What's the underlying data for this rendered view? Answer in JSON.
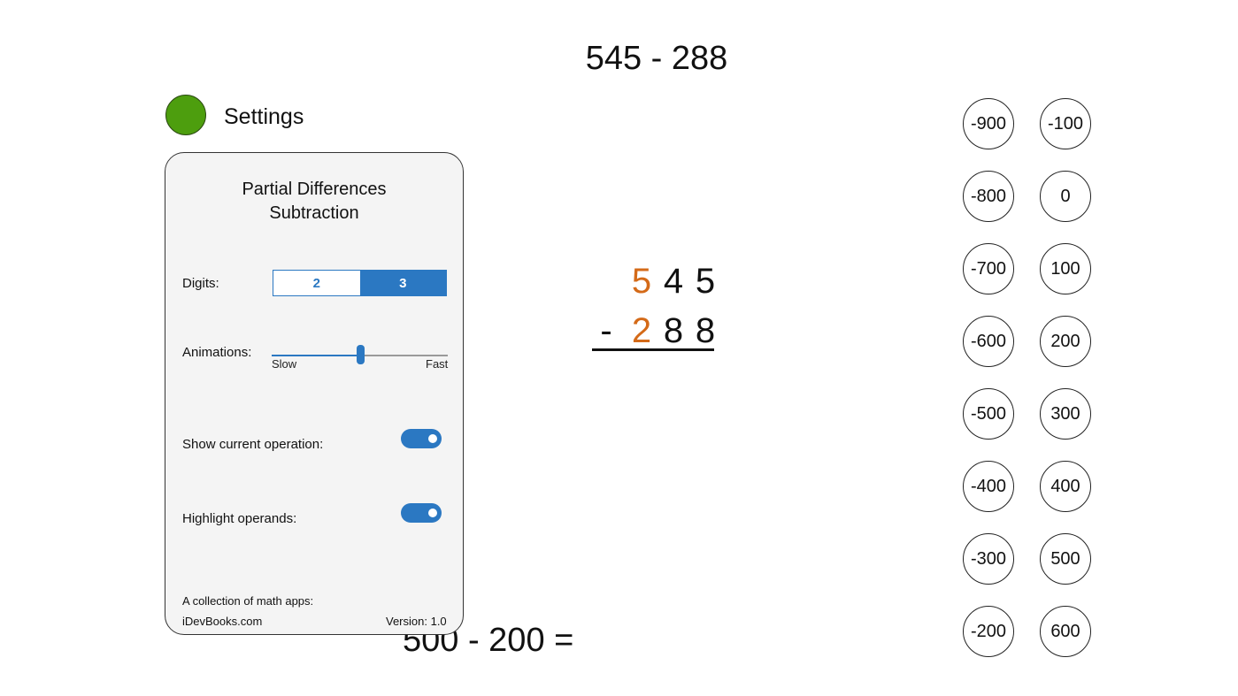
{
  "problem": {
    "title": "545 - 288",
    "equation": "500 - 200 ="
  },
  "settings": {
    "label": "Settings",
    "dot_color": "#4d9e0e",
    "panel": {
      "title_line1": "Partial Differences",
      "title_line2": "Subtraction",
      "digits": {
        "label": "Digits:",
        "options": [
          "2",
          "3"
        ],
        "selected": "3"
      },
      "animations": {
        "label": "Animations:",
        "min_label": "Slow",
        "max_label": "Fast",
        "value": 0.5
      },
      "show_current_operation": {
        "label": "Show current operation:",
        "on": true
      },
      "highlight_operands": {
        "label": "Highlight operands:",
        "on": true
      },
      "footer": {
        "collection_text": "A collection of math apps:",
        "site": "iDevBooks.com",
        "version": "Version: 1.0"
      }
    }
  },
  "vertical": {
    "top_digits": [
      "5",
      "4",
      "5"
    ],
    "operator": "-",
    "bottom_digits": [
      "2",
      "8",
      "8"
    ],
    "highlight_color": "#d46a18"
  },
  "answers": {
    "left_column": [
      "-900",
      "-800",
      "-700",
      "-600",
      "-500",
      "-400",
      "-300",
      "-200"
    ],
    "right_column": [
      "-100",
      "0",
      "100",
      "200",
      "300",
      "400",
      "500",
      "600"
    ]
  },
  "colors": {
    "accent": "#2b78c2",
    "highlight": "#d46a18",
    "settings_dot": "#4d9e0e"
  }
}
